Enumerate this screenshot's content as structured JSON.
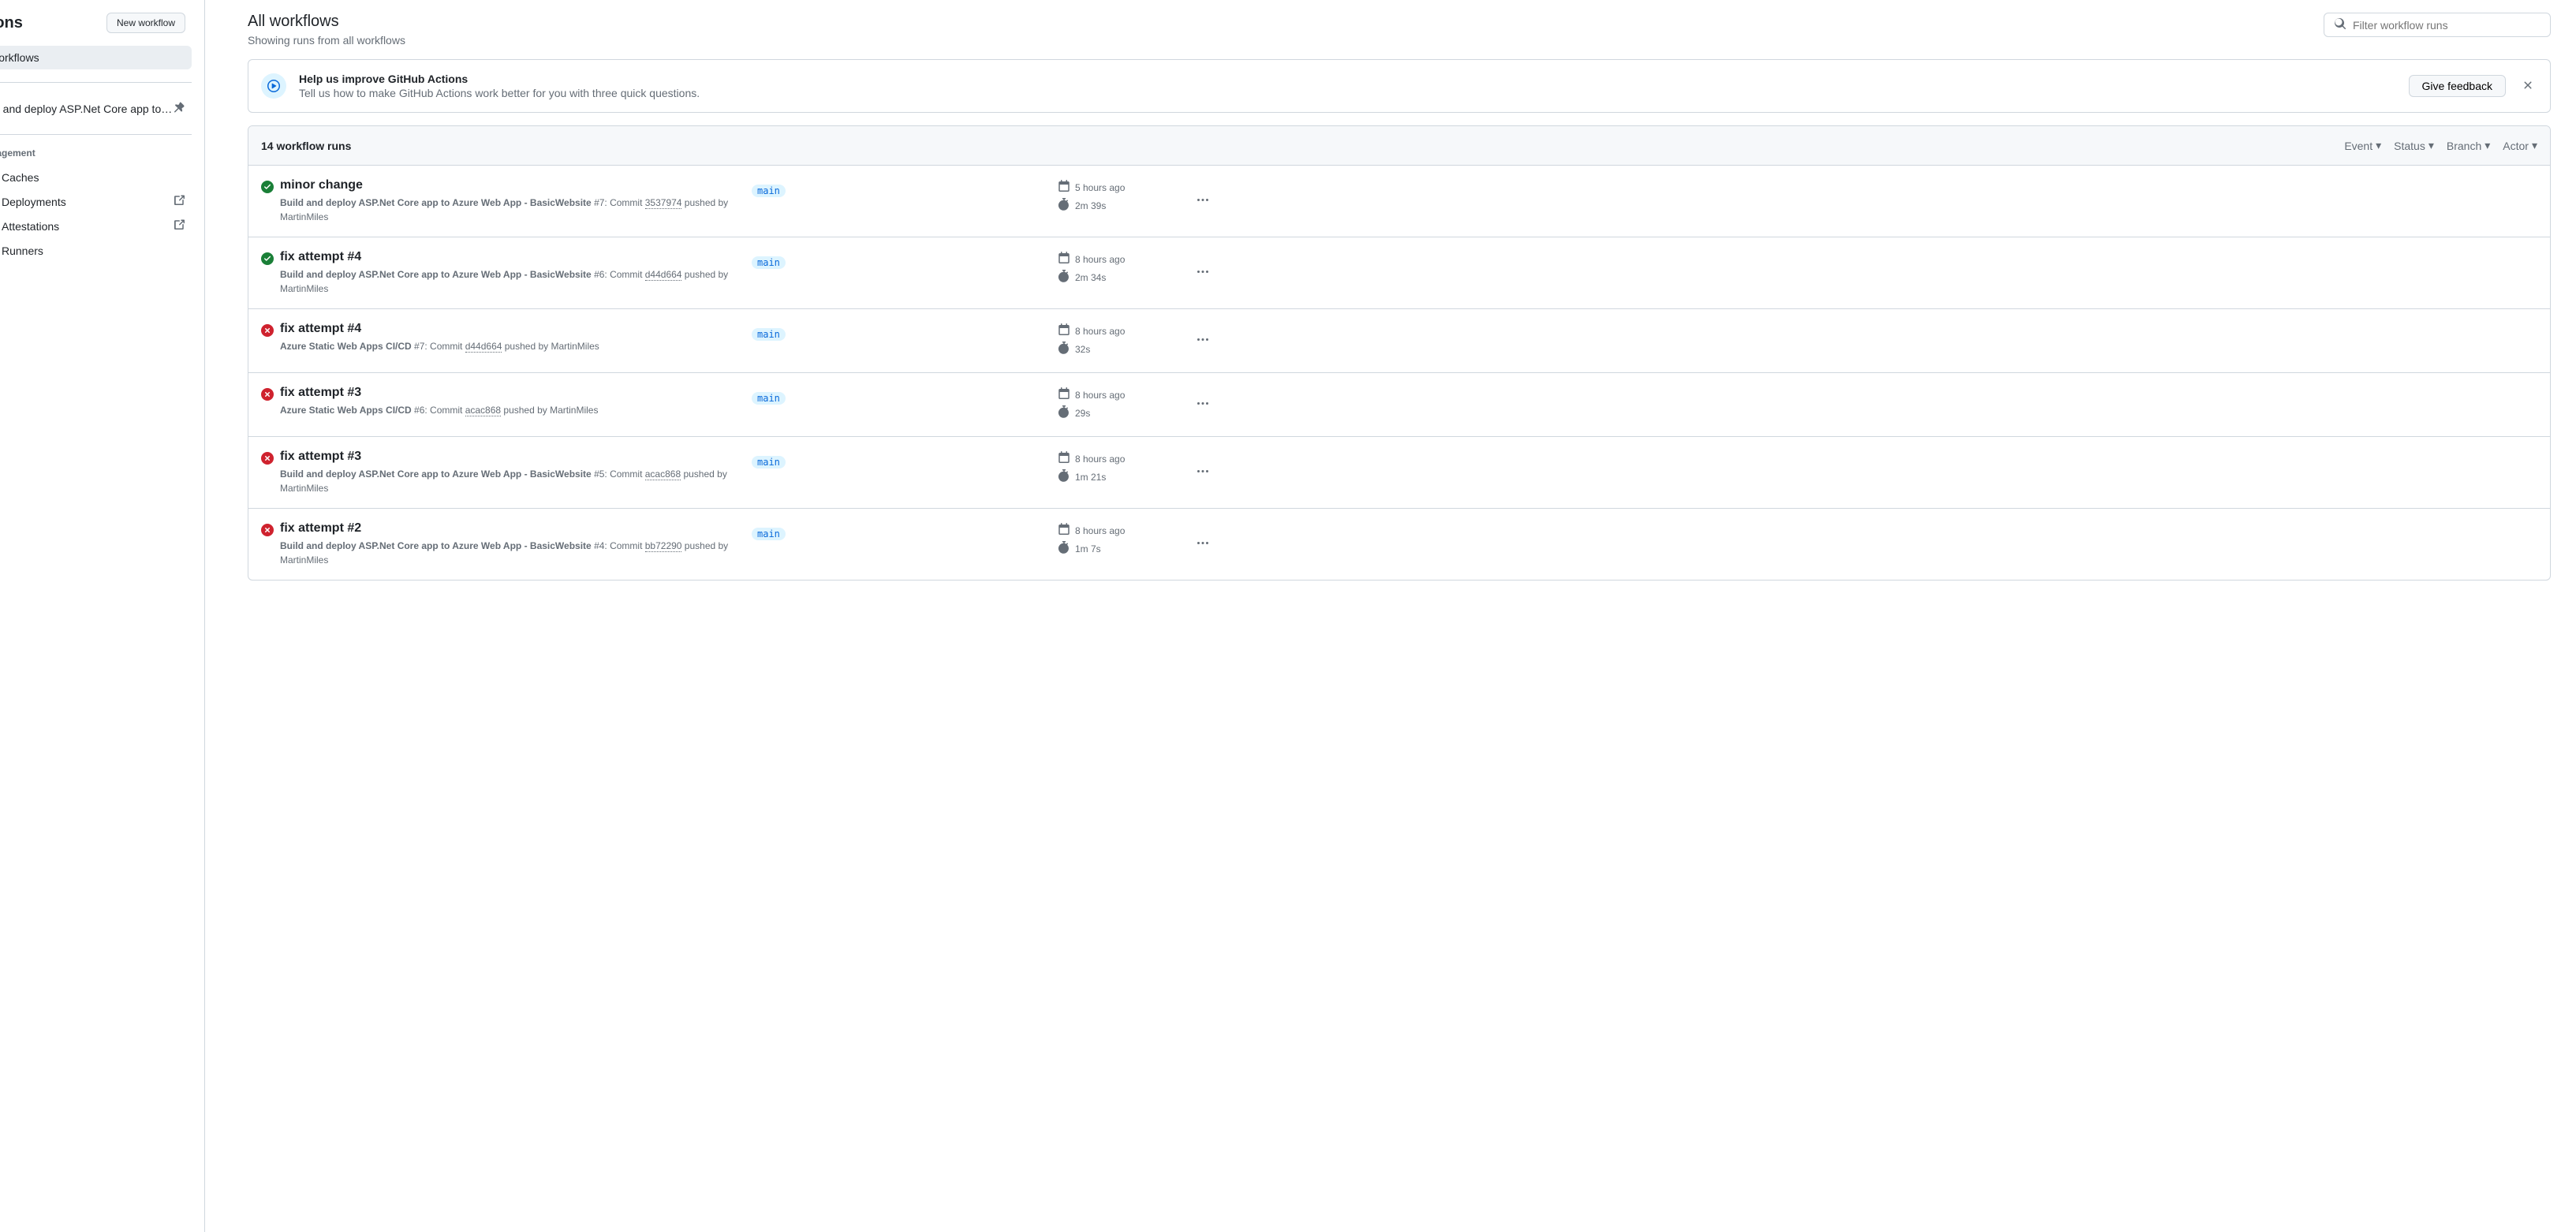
{
  "sidebar": {
    "title": "ctions",
    "new_workflow": "New workflow",
    "all_workflows": "ll workflows",
    "workflow_item": "uild and deploy ASP.Net Core app to ...",
    "management_label": "lanagement",
    "caches": "Caches",
    "deployments": "Deployments",
    "attestations": "Attestations",
    "runners": "Runners"
  },
  "header": {
    "title": "All workflows",
    "subtitle": "Showing runs from all workflows",
    "search_placeholder": "Filter workflow runs"
  },
  "banner": {
    "title": "Help us improve GitHub Actions",
    "desc": "Tell us how to make GitHub Actions work better for you with three quick questions.",
    "button": "Give feedback"
  },
  "list": {
    "count": "14 workflow runs",
    "filters": {
      "event": "Event",
      "status": "Status",
      "branch": "Branch",
      "actor": "Actor"
    }
  },
  "runs": [
    {
      "status": "success",
      "title": "minor change",
      "workflow": "Build and deploy ASP.Net Core app to Azure Web App - BasicWebsite",
      "run_num": "#7",
      "commit_prefix": ": Commit ",
      "sha": "3537974",
      "pushed_by": " pushed by MartinMiles",
      "branch": "main",
      "time": "5 hours ago",
      "duration": "2m 39s"
    },
    {
      "status": "success",
      "title": "fix attempt #4",
      "workflow": "Build and deploy ASP.Net Core app to Azure Web App - BasicWebsite",
      "run_num": "#6",
      "commit_prefix": ": Commit ",
      "sha": "d44d664",
      "pushed_by": " pushed by MartinMiles",
      "branch": "main",
      "time": "8 hours ago",
      "duration": "2m 34s"
    },
    {
      "status": "failure",
      "title": "fix attempt #4",
      "workflow": "Azure Static Web Apps CI/CD",
      "run_num": "#7",
      "commit_prefix": ": Commit ",
      "sha": "d44d664",
      "pushed_by": " pushed by MartinMiles",
      "branch": "main",
      "time": "8 hours ago",
      "duration": "32s"
    },
    {
      "status": "failure",
      "title": "fix attempt #3",
      "workflow": "Azure Static Web Apps CI/CD",
      "run_num": "#6",
      "commit_prefix": ": Commit ",
      "sha": "acac868",
      "pushed_by": " pushed by MartinMiles",
      "branch": "main",
      "time": "8 hours ago",
      "duration": "29s"
    },
    {
      "status": "failure",
      "title": "fix attempt #3",
      "workflow": "Build and deploy ASP.Net Core app to Azure Web App - BasicWebsite",
      "run_num": "#5",
      "commit_prefix": ": Commit ",
      "sha": "acac868",
      "pushed_by": " pushed by MartinMiles",
      "branch": "main",
      "time": "8 hours ago",
      "duration": "1m 21s"
    },
    {
      "status": "failure",
      "title": "fix attempt #2",
      "workflow": "Build and deploy ASP.Net Core app to Azure Web App - BasicWebsite",
      "run_num": "#4",
      "commit_prefix": ": Commit ",
      "sha": "bb72290",
      "pushed_by": " pushed by MartinMiles",
      "branch": "main",
      "time": "8 hours ago",
      "duration": "1m 7s"
    }
  ]
}
